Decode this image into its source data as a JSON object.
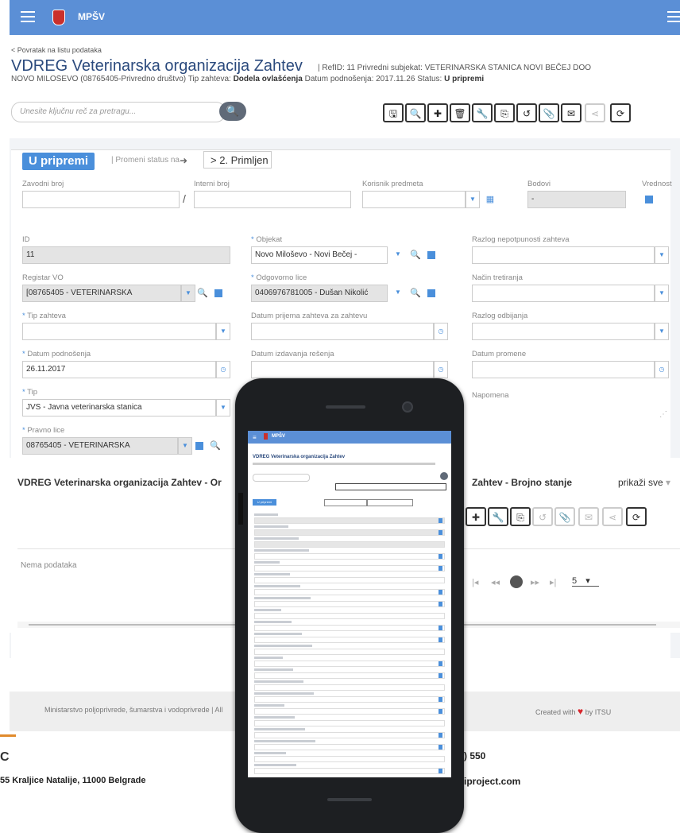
{
  "topbar": {
    "brand": "MPŠV"
  },
  "header": {
    "back_link": "< Povratak na listu podataka",
    "title": "VDREG Veterinarska organizacija Zahtev",
    "meta": "| RefID: 11 Privredni subjekat: VETERINARSKA STANICA NOVI BEČEJ DOO",
    "subline_a": "NOVO MILOŠEVO (08765405-Privredno društvo) Tip zahteva: ",
    "subline_b": "Dodela ovlašćenja",
    "subline_c": " Datum podnošenja: 2017.11.26 Status: ",
    "subline_d": "U pripremi",
    "search_placeholder": "Unesite ključnu reč za pretragu..."
  },
  "toolbar": {
    "icons": [
      "save-icon",
      "search-icon",
      "add-icon",
      "delete-icon",
      "wrench-icon",
      "copy-icon",
      "history-icon",
      "attach-icon",
      "email-icon",
      "share-icon",
      "refresh-icon"
    ],
    "glyphs": [
      "🖫",
      "🔍",
      "✚",
      "🗑",
      "🔧",
      "⎘",
      "↺",
      "📎",
      "✉",
      "⋖",
      "⟳"
    ]
  },
  "status": {
    "current": "U pripremi",
    "change_label": "| Promeni status na",
    "next": "> 2. Primljen"
  },
  "fields_top": {
    "zavodni_broj": "Zavodni broj",
    "interni_broj": "Interni broj",
    "korisnik": "Korisnik predmeta",
    "bodovi": "Bodovi",
    "bodovi_value": "-",
    "vrednost": "Vrednost"
  },
  "form": {
    "id_label": "ID",
    "id_value": "11",
    "registar_label": "Registar VO",
    "registar_value": "[08765405 - VETERINARSKA",
    "tip_zahteva_label": "Tip zahteva",
    "datum_podnosenja_label": "Datum podnošenja",
    "datum_podnosenja_value": "26.11.2017",
    "tip_label": "Tip",
    "tip_value": "JVS - Javna veterinarska stanica",
    "pravno_lice_label": "Pravno lice",
    "pravno_lice_value": "08765405 - VETERINARSKA",
    "objekat_label": "Objekat",
    "objekat_value": "Novo Miloševo - Novi Bečej -",
    "odgovorno_lice_label": "Odgovorno lice",
    "odgovorno_lice_value": "0406976781005 - Dušan Nikolić",
    "datum_dolaska_label": "Datum prijema zahteva za zahtevu",
    "datum_izdavanja_label": "Datum izdavanja rešenja",
    "razlog_label": "Razlog nepotpunosti zahteva",
    "nacin_label": "Način tretiranja",
    "razlog_odbijanja_label": "Razlog odbijanja",
    "datum_promene_label": "Datum promene",
    "napomena_label": "Napomena"
  },
  "grid": {
    "title": "VDREG Veterinarska organizacija Zahtev - Or",
    "title_right": "Zahtev - Brojno stanje",
    "show_all": "prikaži sve",
    "no_rows": "Nema podataka",
    "page_size": "5",
    "pager_icons": [
      "first-page-icon",
      "prev-page-icon",
      "current-page-icon",
      "next-page-icon",
      "last-page-icon"
    ]
  },
  "footer": {
    "text": "Ministarstvo poljoprivrede, šumarstva i vodoprivrede | All",
    "credit_pre": "Created with",
    "credit_post": "by ITSU"
  },
  "company": {
    "letter": "C",
    "address": "55  Kraljice Natalije, 11000 Belgrade",
    "phone": ") 550",
    "web": "iproject.com"
  },
  "mobile": {
    "brand": "MPŠV",
    "title": "VDREG Veterinarska organizacija Zahtev",
    "status": "U pripremi"
  }
}
